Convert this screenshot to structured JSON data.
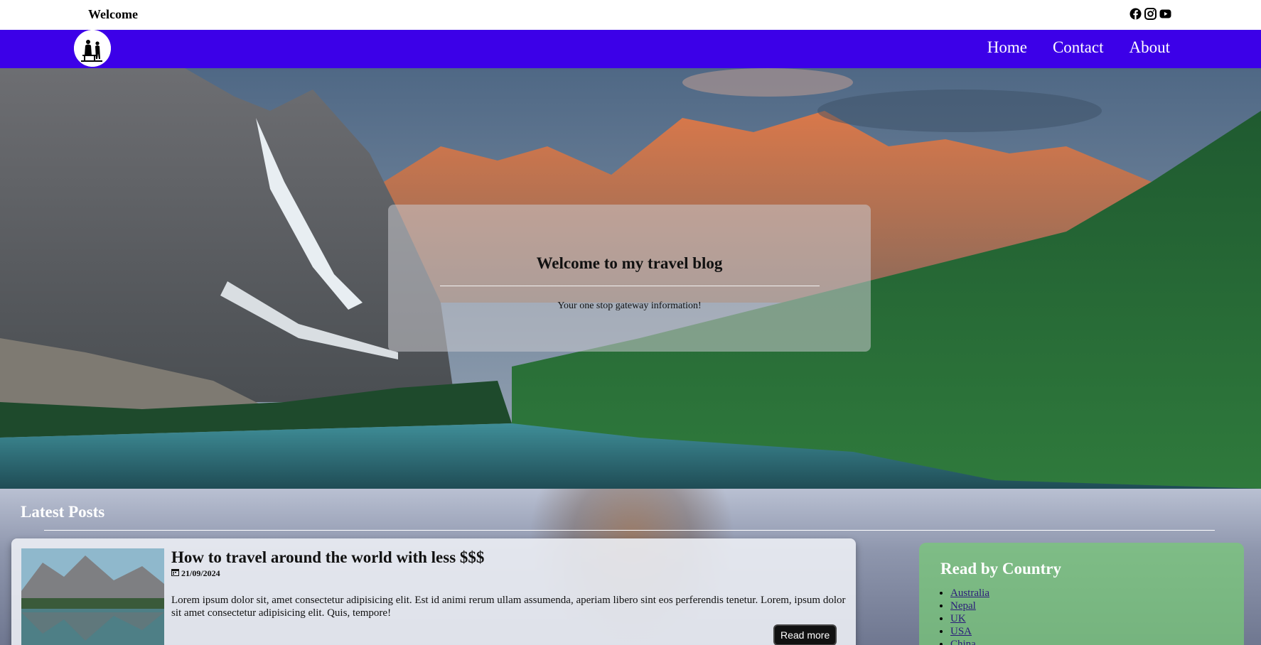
{
  "topbar": {
    "welcome": "Welcome",
    "socials": [
      "facebook-icon",
      "instagram-icon",
      "youtube-icon"
    ]
  },
  "nav": {
    "links": [
      "Home",
      "Contact",
      "About"
    ],
    "bg_color": "#3c00e8"
  },
  "hero": {
    "title": "Welcome to my travel blog",
    "subtitle": "Your one stop gateway information!"
  },
  "latest": {
    "heading": "Latest Posts",
    "posts": [
      {
        "title": "How to travel around the world with less $$$",
        "date": "21/09/2024",
        "body": "Lorem ipsum dolor sit, amet consectetur adipisicing elit. Est id animi rerum ullam assumenda, aperiam libero sint eos perferendis tenetur. Lorem, ipsum dolor sit amet consectetur adipisicing elit. Quis, tempore!",
        "read_more": "Read more"
      }
    ]
  },
  "countries": {
    "heading": "Read by Country",
    "items": [
      "Australia",
      "Nepal",
      "UK",
      "USA",
      "China"
    ]
  }
}
